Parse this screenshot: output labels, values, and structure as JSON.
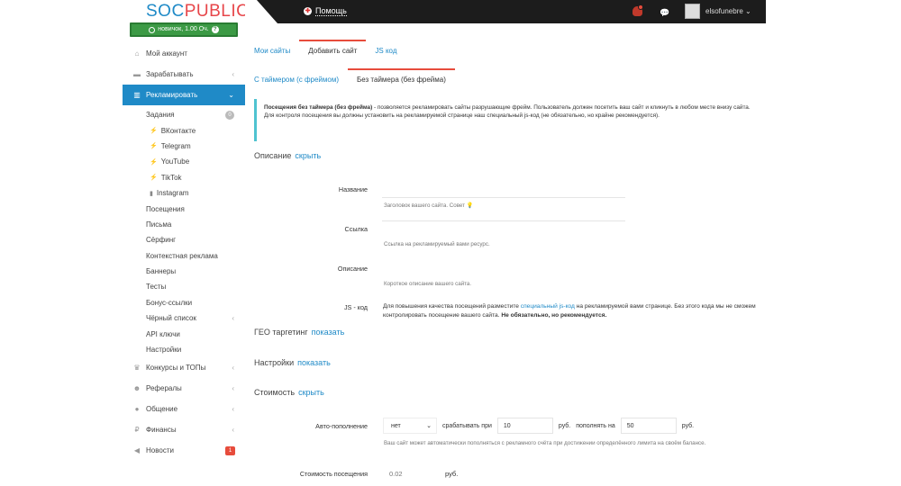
{
  "logo": {
    "part1": "SOC",
    "part2": "PUBLIC"
  },
  "rank": {
    "text": "новичок, 1.00 Оч."
  },
  "menu": {
    "account": "Мой аккаунт",
    "earn": "Зарабатывать",
    "advertise": "Рекламировать",
    "tasks": "Задания",
    "tasks_badge": "0",
    "vk": "ВКонтакте",
    "telegram": "Telegram",
    "youtube": "YouTube",
    "tiktok": "TikTok",
    "instagram": "Instagram",
    "visits": "Посещения",
    "letters": "Письма",
    "surfing": "Сёрфинг",
    "context": "Контекстная реклама",
    "banners": "Баннеры",
    "tests": "Тесты",
    "bonus": "Бонус-ссылки",
    "blacklist": "Чёрный список",
    "api": "API ключи",
    "settings": "Настройки",
    "contests": "Конкурсы и ТОПы",
    "referrals": "Рефералы",
    "chat": "Общение",
    "finance": "Финансы",
    "news": "Новости",
    "news_badge": "1"
  },
  "topbar": {
    "help": "Помощь",
    "username": "elsofunebre ⌄"
  },
  "tabs1": [
    "Мои сайты",
    "Добавить сайт",
    "JS код"
  ],
  "tabs2": [
    "С таймером (с фреймом)",
    "Без таймера (без фрейма)"
  ],
  "info": {
    "bold": "Посещения без таймера (без фрейма)",
    "text": " - позволяется рекламировать сайты разрушающие фрейм. Пользователь должен посетить ваш сайт и кликнуть в любом месте внизу сайта. Для контроля посещения вы должны установить на рекламируемой странице наш специальный js-код (не обязательно, но крайне рекомендуется)."
  },
  "sections": {
    "desc": "Описание",
    "desc_link": "скрыть",
    "geo": "ГЕО таргетинг",
    "geo_link": "показать",
    "settings": "Настройки",
    "settings_link": "показать",
    "cost": "Стоимость",
    "cost_link": "скрыть"
  },
  "form": {
    "name_label": "Название",
    "name_help": "Заголовок вашего сайта. Совет 💡",
    "link_label": "Ссылка",
    "link_help": "Ссылка на рекламируемый вами ресурс.",
    "desc_label": "Описание",
    "desc_help": "Короткое описание вашего сайта.",
    "js_label": "JS - код",
    "js_text1": "Для повышения качества посещений разместите ",
    "js_link": "специальный js-код",
    "js_text2": " на рекламируемой вами странице. Без этого кода мы не сможем контролировать посещение вашего сайта. ",
    "js_bold": "Не обязательно, но рекомендуется.",
    "auto_label": "Авто-пополнение",
    "auto_value": "нет",
    "trigger_label": "срабатывать при",
    "trigger_value": "10",
    "rub1": "руб.",
    "refill_label": "пополнять на",
    "refill_value": "50",
    "rub2": "руб.",
    "auto_help": "Ваш сайт может автоматически пополняться с рекламного счёта при достижении определённого лимита на своём балансе.",
    "cost_label": "Стоимость посещения",
    "cost_value": "0.02",
    "cost_unit": "руб."
  }
}
